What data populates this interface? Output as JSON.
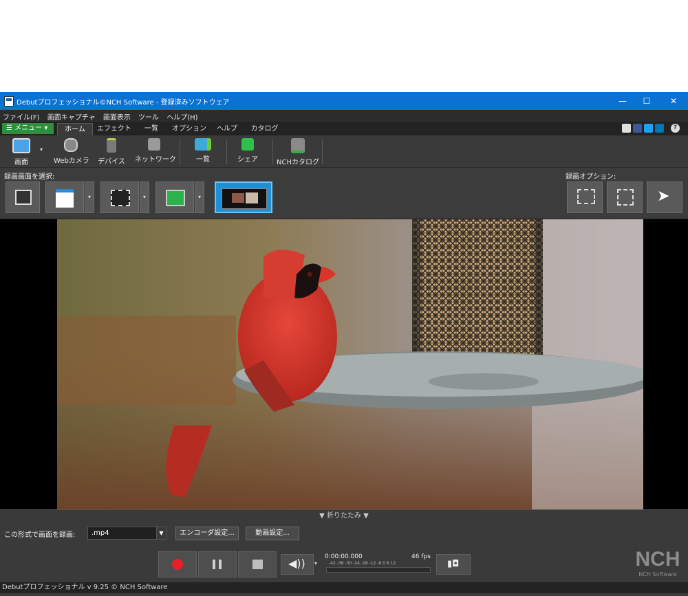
{
  "window": {
    "title": "Debutプロフェッショナル©NCH Software - 登録済みソフトウェア",
    "minimize": "—",
    "maximize": "☐",
    "close": "✕"
  },
  "menubar": [
    "ファイル(F)",
    "画面キャプチャ",
    "画面表示",
    "ツール",
    "ヘルプ(H)"
  ],
  "tabs": {
    "menu_button": "☰ メニュー ▾",
    "items": [
      "ホーム",
      "エフェクト",
      "一覧",
      "オプション",
      "ヘルプ",
      "カタログ"
    ],
    "active": "ホーム",
    "help_icon": "?"
  },
  "toolbar": {
    "items": [
      {
        "label": "画面",
        "icon": "screen-icon"
      },
      {
        "label": "Webカメラ",
        "icon": "webcam-icon"
      },
      {
        "label": "デバイス",
        "icon": "device-icon"
      },
      {
        "label": "ネットワーク",
        "icon": "network-camera-icon"
      },
      {
        "label": "一覧",
        "icon": "recordings-list-icon"
      },
      {
        "label": "シェア",
        "icon": "share-icon"
      },
      {
        "label": "NCHカタログ",
        "icon": "nch-catalog-icon"
      }
    ]
  },
  "capture_select": {
    "label": "録画画面を選択:"
  },
  "record_options": {
    "label": "録画オプション:"
  },
  "collapse": {
    "label": "▼ 折りたたみ ▼"
  },
  "format": {
    "label": "この形式で画面を録画:",
    "value": ".mp4",
    "encoder_button": "エンコーダ設定...",
    "video_button": "動画設定..."
  },
  "meter": {
    "time": "0:00:00.000",
    "fps": "46 fps",
    "scale": "-42 -36 -30 -24 -18 -12 -6 0 6 12"
  },
  "brand": {
    "logo": "NCH",
    "caption": "NCH Software"
  },
  "status": {
    "text": "Debutプロフェッショナル v 9.25 © NCH Software"
  },
  "colors": {
    "titlebar": "#0b72d4",
    "menu_button": "#2f8f3f",
    "record": "#e8202a",
    "selected_capture": "#1e90d8"
  }
}
